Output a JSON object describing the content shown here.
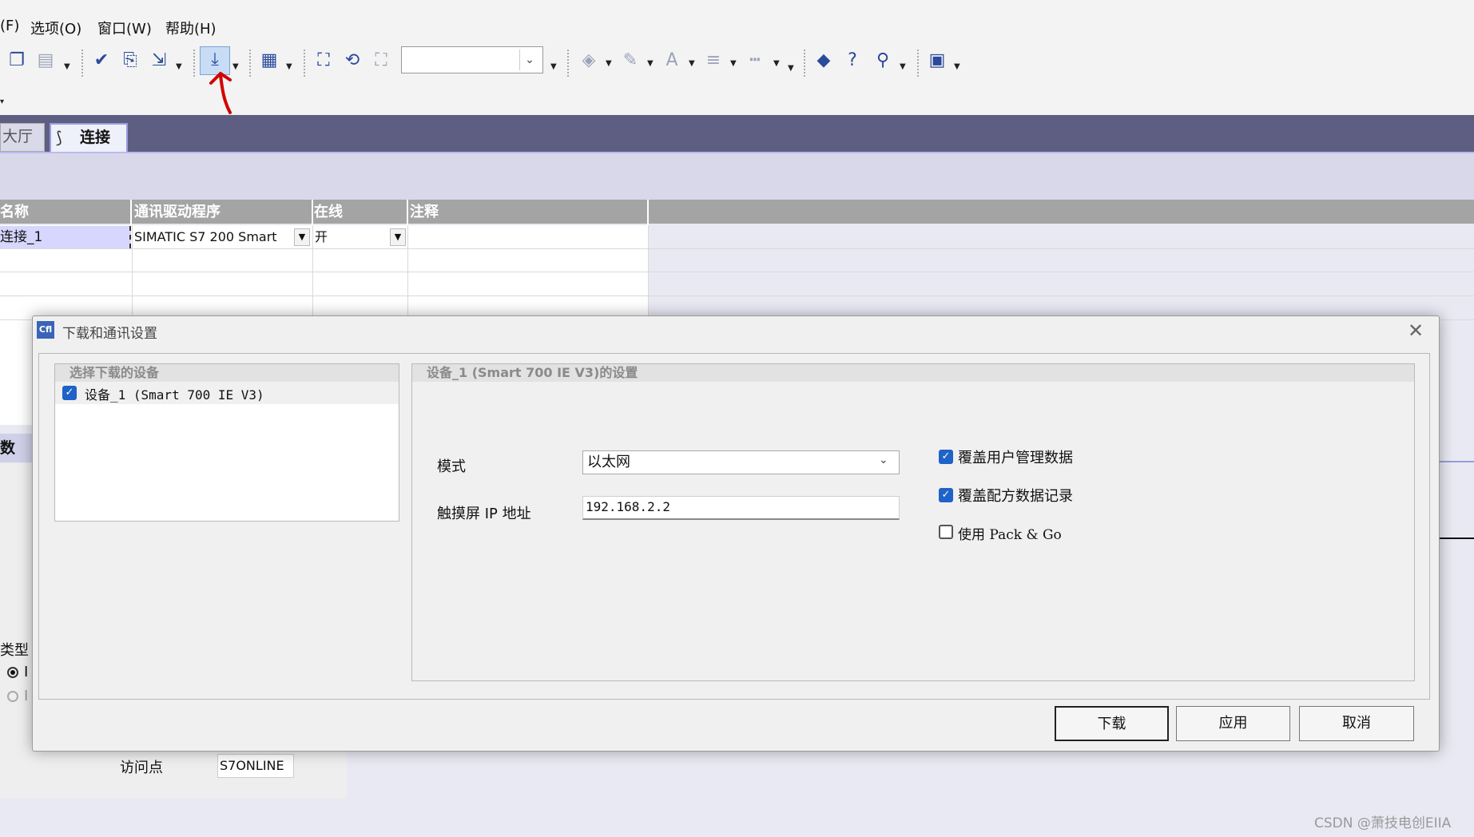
{
  "menu": {
    "cut_item": "(F)",
    "options": "选项(O)",
    "window": "窗口(W)",
    "help": "帮助(H)"
  },
  "tabs": {
    "hall": "大厅",
    "connection": "连接"
  },
  "grid": {
    "headers": [
      "名称",
      "通讯驱动程序",
      "在线",
      "注释"
    ],
    "row": {
      "name": "连接_1",
      "driver": "SIMATIC S7 200 Smart",
      "online": "开",
      "comment": ""
    }
  },
  "background": {
    "side_tab": "数",
    "type_label": "类型",
    "radio1": "I",
    "radio2": "I",
    "access_point_label": "访问点",
    "access_point_value": "S7ONLINE"
  },
  "dialog": {
    "title": "下载和通讯设置",
    "device_list_header": "选择下载的设备",
    "device_item": "设备_1 (Smart 700 IE V3)",
    "device_item_checked": true,
    "settings_header": "设备_1 (Smart 700 IE V3)的设置",
    "mode_label": "模式",
    "mode_value": "以太网",
    "ip_label": "触摸屏 IP 地址",
    "ip_value": "192.168.2.2",
    "overwrite_user_admin": "覆盖用户管理数据",
    "overwrite_user_admin_checked": true,
    "overwrite_recipe": "覆盖配方数据记录",
    "overwrite_recipe_checked": true,
    "use_pack_go": "使用 Pack & Go",
    "use_pack_go_checked": false,
    "buttons": {
      "download": "下载",
      "apply": "应用",
      "cancel": "取消"
    }
  },
  "watermark": "CSDN @萧技电创EIIA",
  "colors": {
    "tabstrip": "#5e5e82",
    "checkbox_blue": "#1f62c8",
    "annotation_red": "#d40000"
  }
}
